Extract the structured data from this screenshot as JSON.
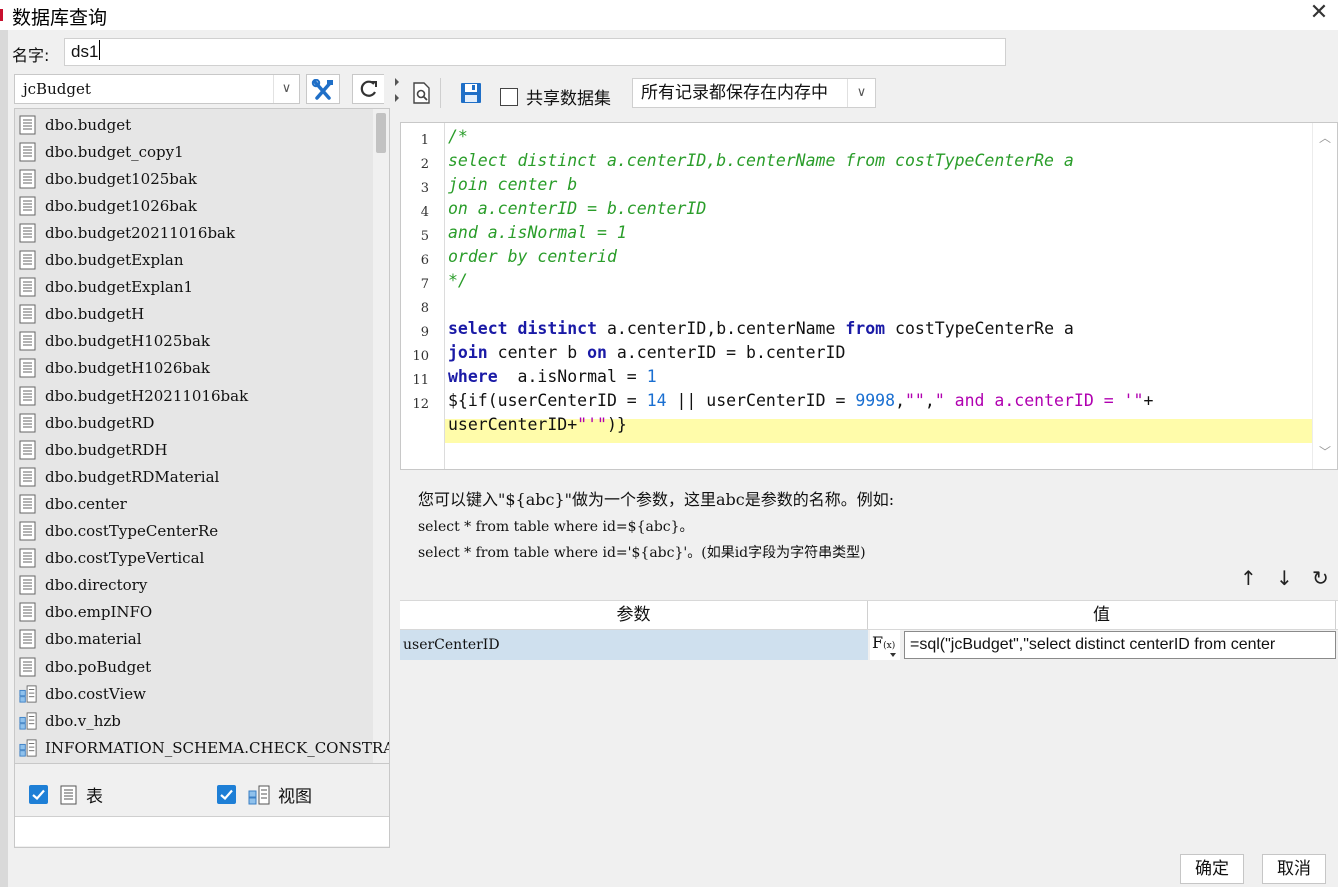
{
  "window": {
    "title": "数据库查询",
    "close_glyph": "✕"
  },
  "name_field": {
    "label": "名字:",
    "value": "ds1"
  },
  "left": {
    "datasource": "jcBudget",
    "dropdown_glyph": "∨",
    "items": [
      {
        "label": "dbo.budget",
        "kind": "table"
      },
      {
        "label": "dbo.budget_copy1",
        "kind": "table"
      },
      {
        "label": "dbo.budget1025bak",
        "kind": "table"
      },
      {
        "label": "dbo.budget1026bak",
        "kind": "table"
      },
      {
        "label": "dbo.budget20211016bak",
        "kind": "table"
      },
      {
        "label": "dbo.budgetExplan",
        "kind": "table"
      },
      {
        "label": "dbo.budgetExplan1",
        "kind": "table"
      },
      {
        "label": "dbo.budgetH",
        "kind": "table"
      },
      {
        "label": "dbo.budgetH1025bak",
        "kind": "table"
      },
      {
        "label": "dbo.budgetH1026bak",
        "kind": "table"
      },
      {
        "label": "dbo.budgetH20211016bak",
        "kind": "table"
      },
      {
        "label": "dbo.budgetRD",
        "kind": "table"
      },
      {
        "label": "dbo.budgetRDH",
        "kind": "table"
      },
      {
        "label": "dbo.budgetRDMaterial",
        "kind": "table"
      },
      {
        "label": "dbo.center",
        "kind": "table"
      },
      {
        "label": "dbo.costTypeCenterRe",
        "kind": "table"
      },
      {
        "label": "dbo.costTypeVertical",
        "kind": "table"
      },
      {
        "label": "dbo.directory",
        "kind": "table"
      },
      {
        "label": "dbo.empINFO",
        "kind": "table"
      },
      {
        "label": "dbo.material",
        "kind": "table"
      },
      {
        "label": "dbo.poBudget",
        "kind": "table"
      },
      {
        "label": "dbo.costView",
        "kind": "view"
      },
      {
        "label": "dbo.v_hzb",
        "kind": "view"
      },
      {
        "label": "INFORMATION_SCHEMA.CHECK_CONSTRAINTS",
        "kind": "view"
      }
    ],
    "filter_table_label": "表",
    "filter_view_label": "视图"
  },
  "toolbar": {
    "share_label": "共享数据集",
    "memory_option": "所有记录都保存在内存中",
    "dropdown_glyph": "∨"
  },
  "editor": {
    "line_numbers": [
      "1",
      "2",
      "3",
      "4",
      "5",
      "6",
      "7",
      "8",
      "9",
      "10",
      "11",
      "12"
    ],
    "l1": "/*",
    "l2": "select distinct a.centerID,b.centerName from costTypeCenterRe a",
    "l3": "join center b",
    "l4": "on a.centerID = b.centerID",
    "l5": "and a.isNormal = 1",
    "l6": "order by centerid",
    "l7": "*/",
    "l9_kw1": "select distinct",
    "l9_t1": " a.centerID,b.centerName ",
    "l9_kw2": "from",
    "l9_t2": " costTypeCenterRe a",
    "l10_kw1": "join",
    "l10_t1": " center b ",
    "l10_kw2": "on",
    "l10_t2": " a.centerID = b.centerID",
    "l11_kw": "where",
    "l11_t1": "  a.isNormal = ",
    "l11_n": "1",
    "l12_t1": "${if(userCenterID = ",
    "l12_n1": "14",
    "l12_t2": " || userCenterID = ",
    "l12_n2": "9998",
    "l12_t3": ",",
    "l12_s1": "\"\"",
    "l12_t4": ",",
    "l12_s2": "\" and a.centerID = '\"",
    "l12_t5": "+",
    "l12w_t1": "userCenterID+",
    "l12w_s1": "\"'\"",
    "l12w_t2": ")}"
  },
  "hint": {
    "line1": "您可以键入\"${abc}\"做为一个参数，这里abc是参数的名称。例如:",
    "line2": "select * from table where id=${abc}。",
    "line3": "select * from table where id='${abc}'。(如果id字段为字符串类型)"
  },
  "param_tools": {
    "up": "↑",
    "down": "↓",
    "refresh": "↻"
  },
  "params": {
    "col_param": "参数",
    "col_value": "值",
    "row_name": "userCenterID",
    "fx_main": "F",
    "fx_sub": "(x)",
    "row_value": "=sql(\"jcBudget\",\"select distinct centerID from center"
  },
  "buttons": {
    "ok": "确定",
    "cancel": "取消"
  },
  "colors": {
    "comment": "#2a9d2a",
    "keyword": "#1a1aa6",
    "number": "#1a6fd1",
    "string": "#b000b0",
    "highlight": "#fffcaa",
    "selected_row": "#cfe0ee",
    "checkbox": "#1e7fd6"
  }
}
